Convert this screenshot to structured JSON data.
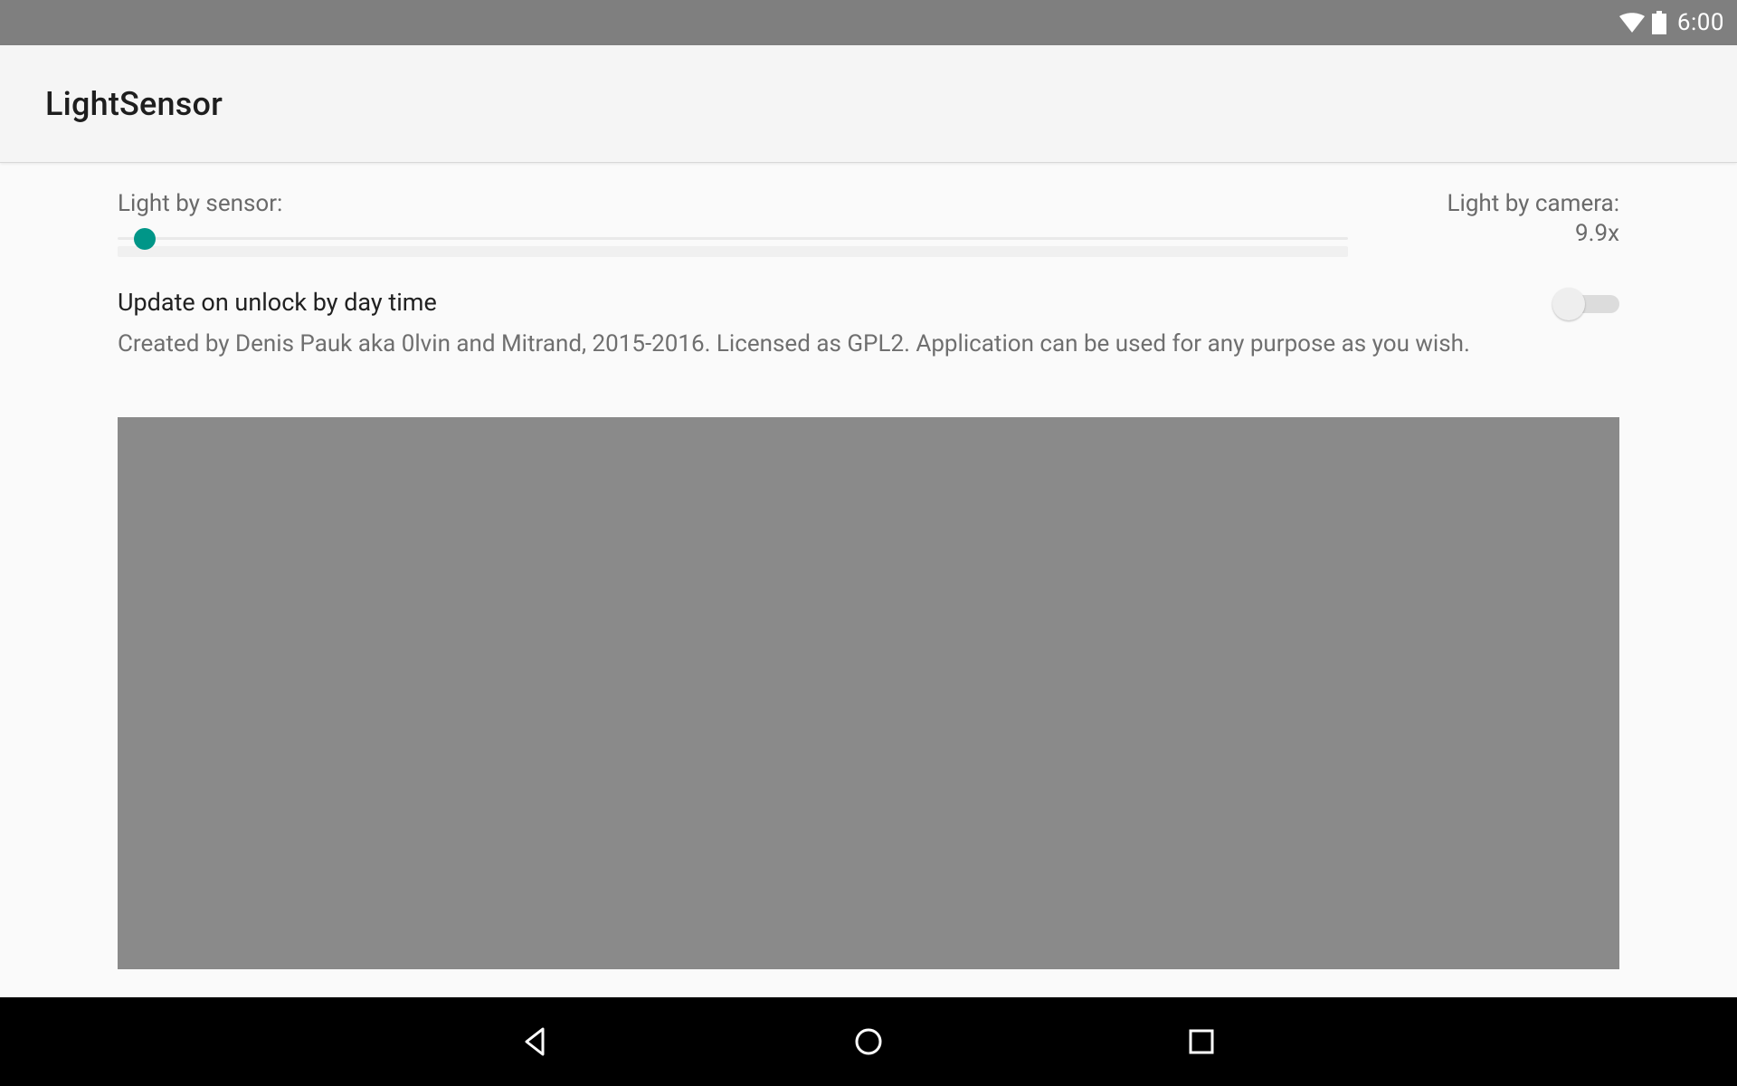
{
  "status": {
    "time": "6:00"
  },
  "appbar": {
    "title": "LightSensor"
  },
  "sensor": {
    "label_sensor": "Light by sensor:",
    "label_camera": "Light by camera:",
    "value_camera": "9.9x"
  },
  "setting": {
    "title": "Update on unlock by day time",
    "description": "Created by Denis Pauk aka 0lvin and Mitrand, 2015-2016. Licensed as GPL2. Application can be used for any purpose as you wish."
  }
}
